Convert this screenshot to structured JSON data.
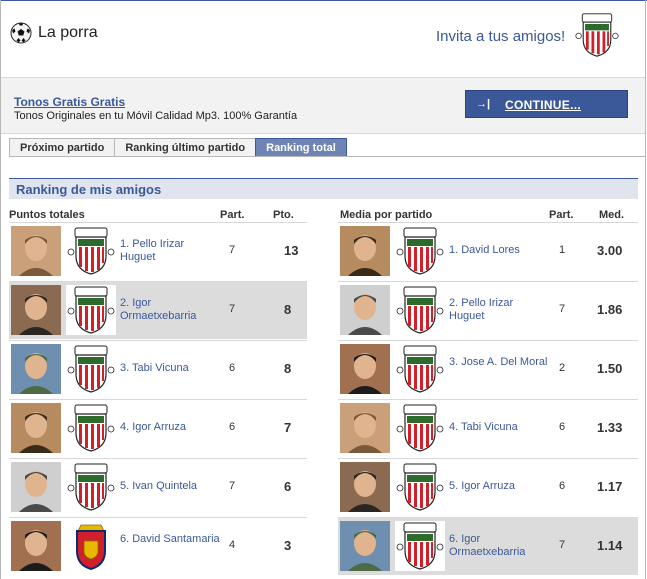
{
  "header": {
    "title": "La porra",
    "invite": "Invita a tus amigos!",
    "crest_text": "ATHLETIC CLUB"
  },
  "ad": {
    "title": "Tonos Gratis Gratis",
    "text": "Tonos Originales en tu Móvil Calidad Mp3. 100% Garantía",
    "button": "CONTINUE...",
    "button_icon": "arrow-to-line-icon"
  },
  "tabs": [
    {
      "label": "Próximo partido",
      "active": false
    },
    {
      "label": "Ranking último partido",
      "active": false
    },
    {
      "label": "Ranking total",
      "active": true
    }
  ],
  "section": {
    "title": "Ranking de mis amigos"
  },
  "left": {
    "header_main": "Puntos totales",
    "header_part": "Part.",
    "header_score": "Pto.",
    "rows": [
      {
        "name": "1. Pello Irizar Huguet",
        "part": "7",
        "score": "13",
        "highlighted": false,
        "crest": "athletic"
      },
      {
        "name": "2. Igor Ormaetxebarria",
        "part": "7",
        "score": "8",
        "highlighted": true,
        "crest": "athletic"
      },
      {
        "name": "3. Tabi Vicuna",
        "part": "6",
        "score": "8",
        "highlighted": false,
        "crest": "athletic"
      },
      {
        "name": "4. Igor Arruza",
        "part": "6",
        "score": "7",
        "highlighted": false,
        "crest": "athletic"
      },
      {
        "name": "5. Ivan Quintela",
        "part": "7",
        "score": "6",
        "highlighted": false,
        "crest": "athletic"
      },
      {
        "name": "6. David Santamaria",
        "part": "4",
        "score": "3",
        "highlighted": false,
        "crest": "osasuna"
      }
    ]
  },
  "right": {
    "header_main": "Media por partido",
    "header_part": "Part.",
    "header_score": "Med.",
    "rows": [
      {
        "name": "1. David Lores",
        "part": "1",
        "score": "3.00",
        "highlighted": false,
        "crest": "athletic"
      },
      {
        "name": "2. Pello Irizar Huguet",
        "part": "7",
        "score": "1.86",
        "highlighted": false,
        "crest": "athletic"
      },
      {
        "name": "3. Jose A. Del Moral",
        "part": "2",
        "score": "1.50",
        "highlighted": false,
        "crest": "athletic"
      },
      {
        "name": "4. Tabi Vicuna",
        "part": "6",
        "score": "1.33",
        "highlighted": false,
        "crest": "athletic"
      },
      {
        "name": "5. Igor Arruza",
        "part": "6",
        "score": "1.17",
        "highlighted": false,
        "crest": "athletic"
      },
      {
        "name": "6. Igor Ormaetxebarria",
        "part": "7",
        "score": "1.14",
        "highlighted": true,
        "crest": "athletic"
      }
    ]
  },
  "colors": {
    "brand": "#3b5998",
    "tab_active": "#6d84b4",
    "section_bg": "#dfe4ee",
    "row_highlight": "#dcdcdc",
    "crest_red": "#d0202a"
  }
}
